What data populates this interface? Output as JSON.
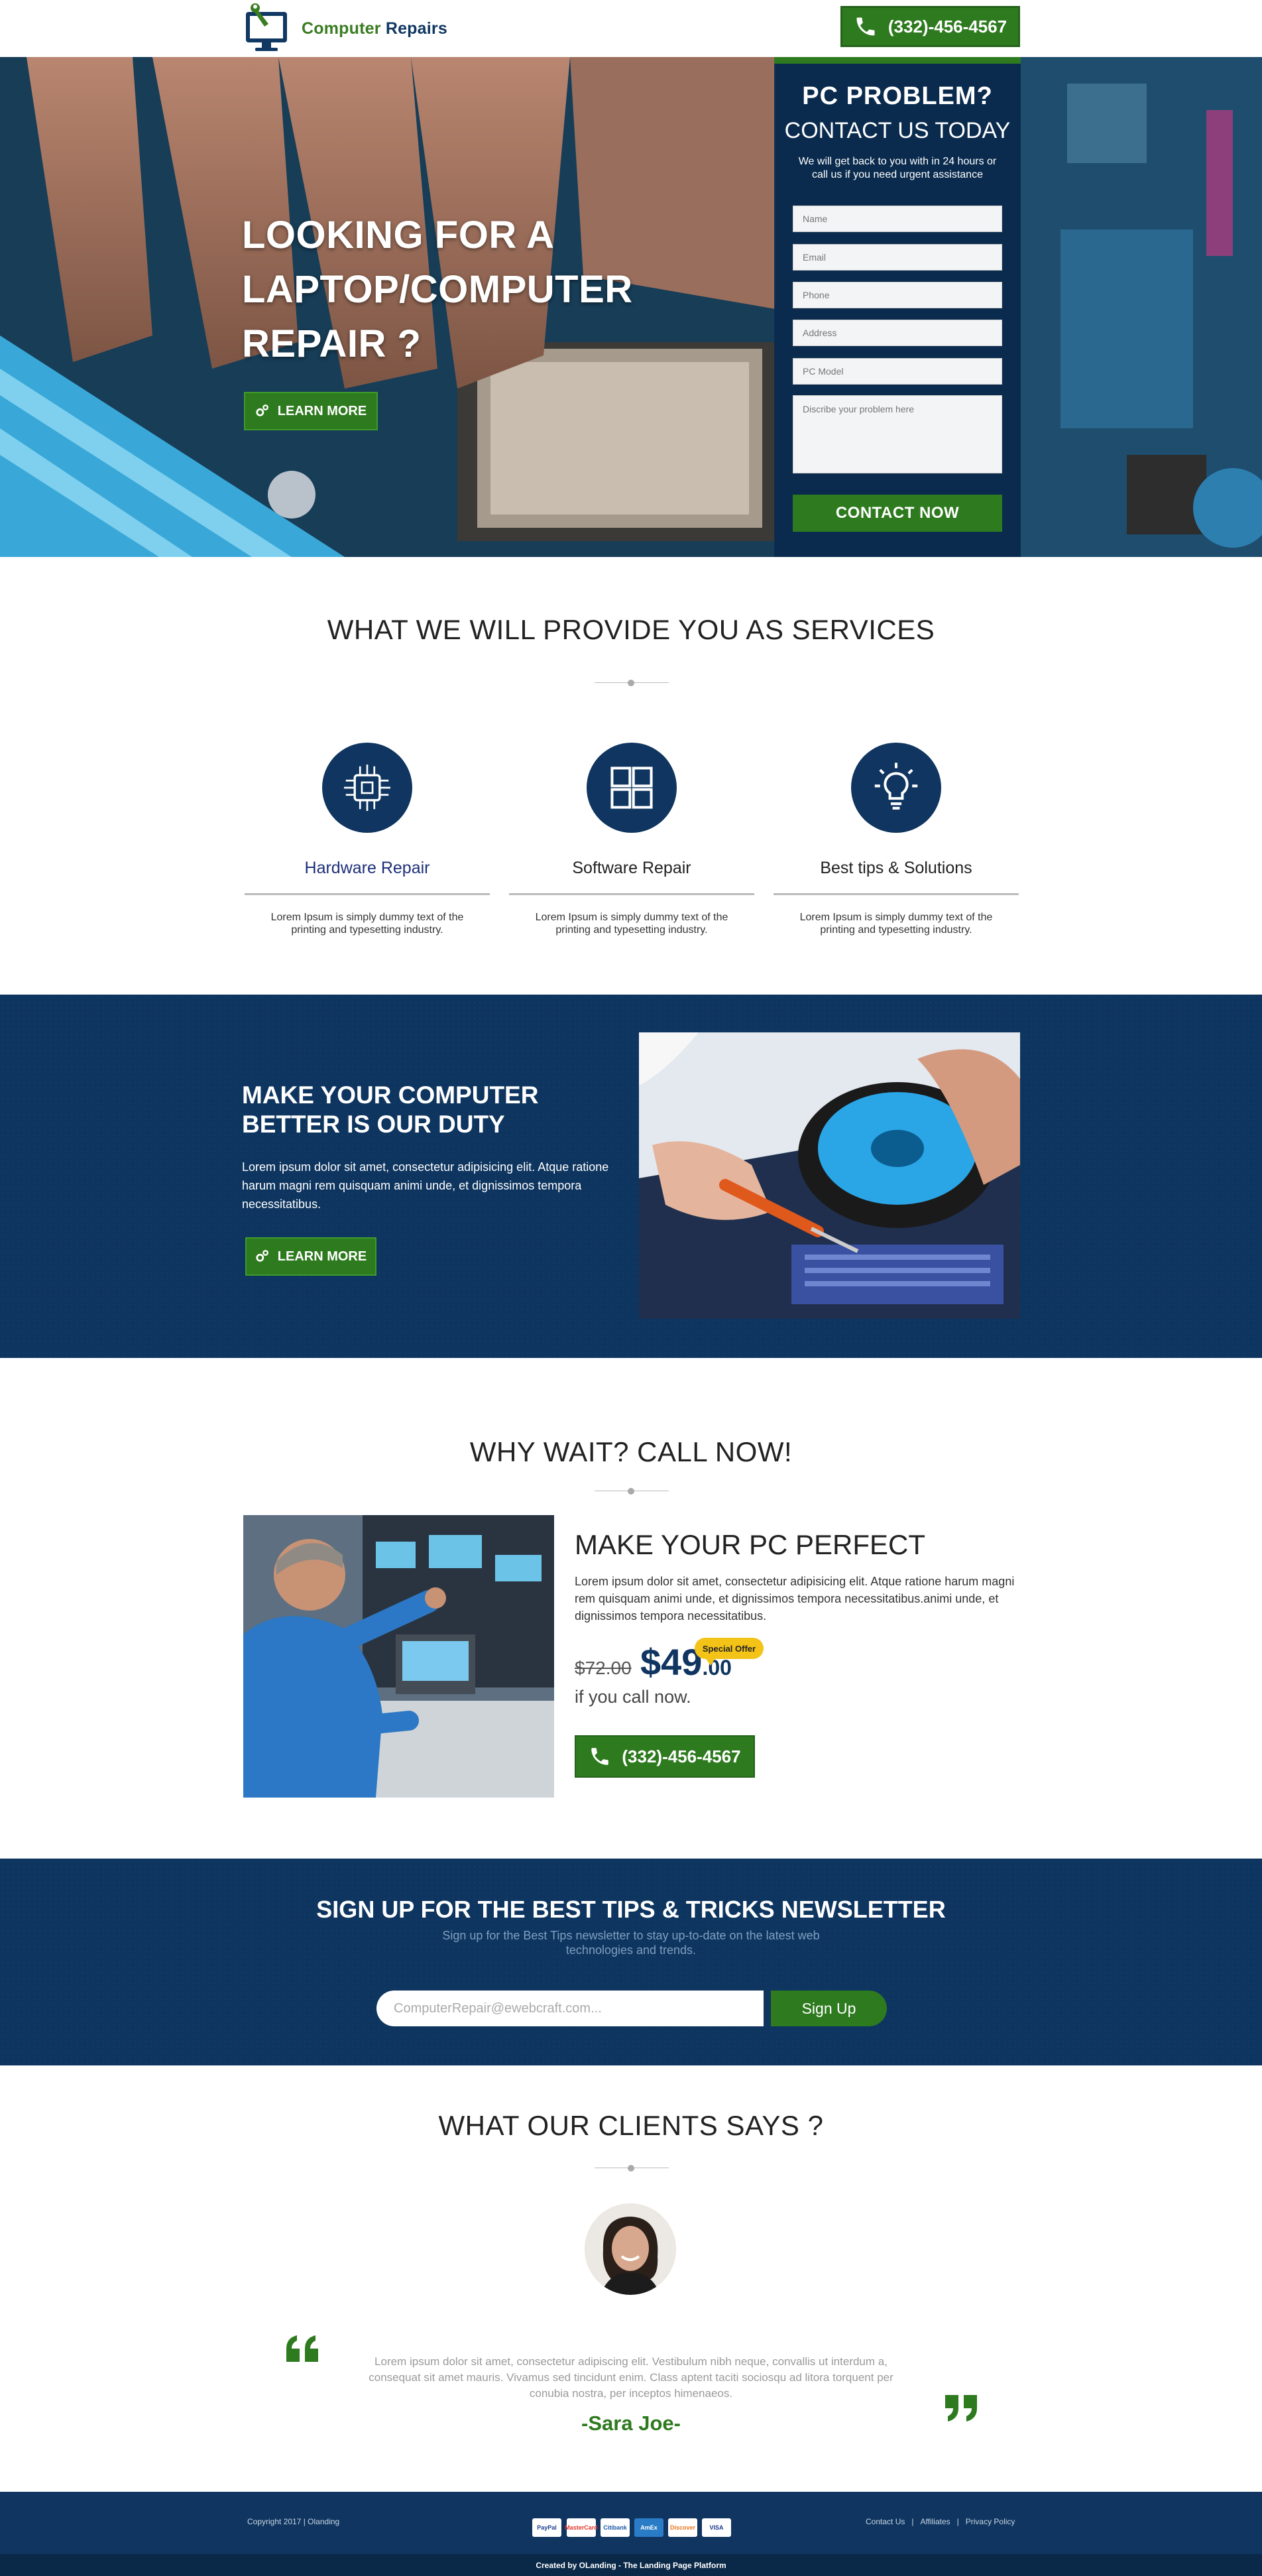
{
  "header": {
    "logo_word1": "Computer",
    "logo_word2": "Repairs",
    "phone": "(332)-456-4567"
  },
  "hero": {
    "title": "LOOKING FOR A LAPTOP/COMPUTER REPAIR ?",
    "learn_more": "LEARN MORE"
  },
  "form": {
    "heading": "PC PROBLEM?",
    "subheading": "CONTACT US TODAY",
    "note": "We will get back to you with in 24 hours or call us if you need urgent assistance",
    "fields": {
      "name": "Name",
      "email": "Email",
      "phone": "Phone",
      "address": "Address",
      "pc_model": "PC Model",
      "problem": "Discribe your problem here"
    },
    "submit": "CONTACT NOW"
  },
  "services": {
    "title": "WHAT WE WILL PROVIDE YOU AS SERVICES",
    "items": [
      {
        "title": "Hardware Repair",
        "desc": "Lorem Ipsum is simply dummy text of the printing and typesetting industry.",
        "icon": "chip-icon"
      },
      {
        "title": "Software Repair",
        "desc": "Lorem Ipsum is simply dummy text of the printing and typesetting industry.",
        "icon": "windows-icon"
      },
      {
        "title": "Best tips & Solutions",
        "desc": "Lorem Ipsum is simply dummy text of the printing and typesetting industry.",
        "icon": "lightbulb-icon"
      }
    ]
  },
  "duty": {
    "title": "MAKE YOUR COMPUTER BETTER IS OUR DUTY",
    "text": "Lorem ipsum dolor sit amet, consectetur adipisicing elit. Atque ratione harum magni rem quisquam animi unde, et dignissimos tempora necessitatibus.",
    "learn_more": "LEARN MORE"
  },
  "callnow": {
    "title": "WHY WAIT? CALL NOW!",
    "heading": "MAKE YOUR PC PERFECT",
    "text": "Lorem ipsum dolor sit amet, consectetur adipisicing elit. Atque ratione harum magni rem quisquam animi unde, et dignissimos tempora necessitatibus.animi unde, et dignissimos tempora necessitatibus.",
    "old_price": "$72.00",
    "new_price_main": "$49",
    "new_price_cents": ".00",
    "badge": "Special Offer",
    "subtext": "if you call now.",
    "phone": "(332)-456-4567"
  },
  "newsletter": {
    "title": "SIGN UP FOR THE BEST TIPS & TRICKS NEWSLETTER",
    "subtitle": "Sign up for the Best Tips newsletter to stay up-to-date on the latest web technologies and trends.",
    "placeholder": "ComputerRepair@ewebcraft.com...",
    "button": "Sign Up"
  },
  "testimonials": {
    "title": "WHAT OUR CLIENTS SAYS ?",
    "text": "Lorem ipsum dolor sit amet, consectetur adipiscing elit. Vestibulum nibh neque, convallis ut interdum a, consequat sit amet mauris. Vivamus sed tincidunt enim. Class aptent taciti sociosqu ad litora torquent per conubia nostra, per inceptos himenaeos.",
    "name": "-Sara Joe-"
  },
  "footer": {
    "copyright": "Copyright 2017 | Olanding",
    "payments": [
      "PayPal",
      "MasterCard",
      "Citibank",
      "AmEx",
      "Discover",
      "VISA"
    ],
    "links": [
      "Contact Us",
      "Affiliates",
      "Privacy Policy"
    ],
    "credit": "Created by OLanding - The Landing Page Platform"
  },
  "colors": {
    "brand_green": "#2e7a1e",
    "brand_navy": "#0f3560"
  }
}
